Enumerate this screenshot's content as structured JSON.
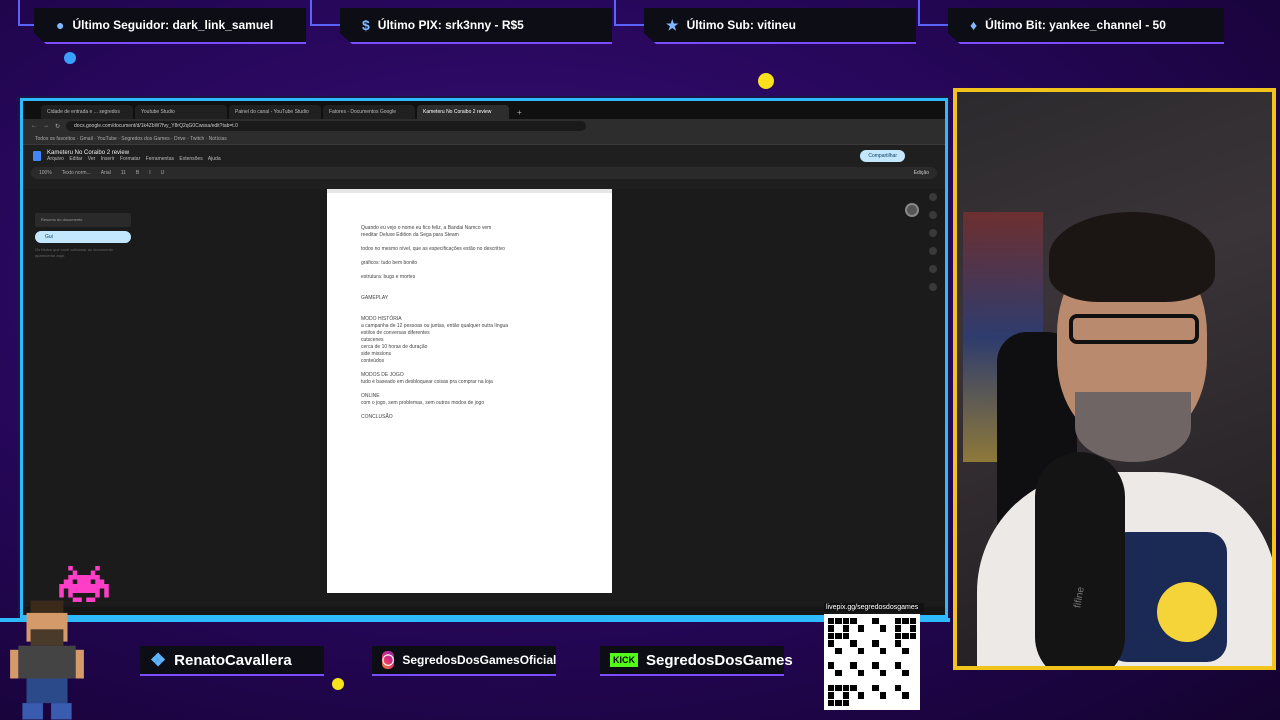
{
  "alerts": {
    "follower": "Último Seguidor: dark_link_samuel",
    "pix": "Último PIX: srk3nny - R$5",
    "sub": "Último Sub: vitineu",
    "bit": "Último Bit: yankee_channel - 50"
  },
  "browser": {
    "tabs": [
      "Cidade de entrada e ... segredos",
      "Youtube Studio",
      "Painel do canal - YouTube Studio",
      "Fatores - Documentos Google",
      "Kameteru No Coraibo 2 review"
    ],
    "url": "docs.google.com/document/d/1k4ZbW7fvy_Y8rQ2qG0Cwsxa/edit?tab=t.0",
    "bookmarks": "Todos os favoritos  ·  Gmail  ·  YouTube  ·  Segredos dos Games  ·  Drive  ·  Twitch  ·  Notícias"
  },
  "doc": {
    "title": "Kameteru No Coraibo 2 review",
    "menus": "Arquivo Editar Ver Inserir Formatar Ferramentas Extensões Ajuda",
    "share_label": "Compartilhar",
    "edit_mode": "Edição",
    "toolbar": {
      "zoom": "100%",
      "style": "Texto norm...",
      "font": "Arial",
      "size": "11"
    },
    "outline": {
      "search_placeholder": "Resumo do documento",
      "item": "Gui",
      "hint": "Os títulos que você adicionar ao documento aparecerão aqui."
    },
    "lines": [
      "Quando eu vejo o nome eu fico feliz, a Bandai Namco vem",
      "reeditar Deluxe Edition da Sega para Steam",
      "",
      "todos no mesmo nível, que as especificações estão no descritivo",
      "",
      "gráficos: tudo bem bonito",
      "",
      "estrutura: bugs e mortes",
      "",
      "",
      "GAMEPLAY",
      "",
      "",
      "MODO HISTÓRIA",
      "a campanha de 12 pessoas ou juntas, então qualquer outra língua",
      "estilos de conversas diferentes",
      "cutscenes",
      "cerca de 10 horas de duração",
      "side missions",
      "conteúdos",
      "",
      "MODOS DE JOGO",
      "tudo é baseado em desbloquear coisas pra comprar na loja",
      "",
      "ONLINE",
      "com o jogo, sem problemas, sem outros modos de jogo",
      "",
      "CONCLUSÃO"
    ]
  },
  "social": {
    "twitter": "RenatoCavallera",
    "instagram": "SegredosDosGamesOficial",
    "kick_badge": "KICK",
    "kick": "SegredosDosGames"
  },
  "qr": {
    "url": "livepix.gg/segredosdosgames"
  },
  "webcam": {
    "mic_brand": "fifine"
  },
  "colors": {
    "accent_blue": "#2fb9ff",
    "accent_yellow": "#f2c31b",
    "alert_border": "#7a4dff"
  }
}
